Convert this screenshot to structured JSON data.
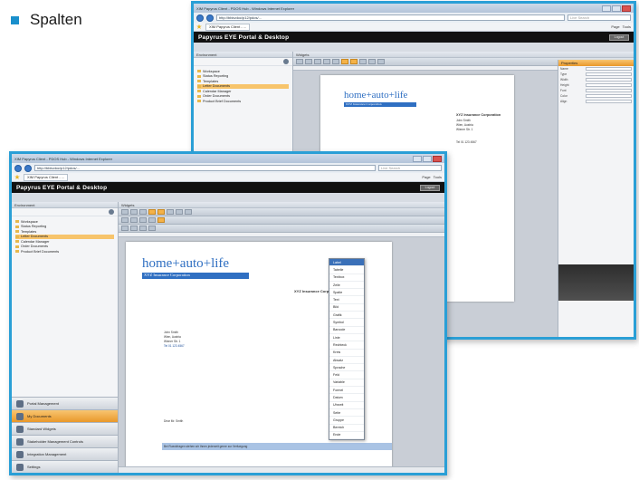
{
  "slide": {
    "bullet": "Spalten",
    "accent_color": "#1a8fcc",
    "frame_color": "#2a9fd6"
  },
  "browser": {
    "title": "XIM Papyrus Client - PDOS Hub - Windows Internet Explorer",
    "url": "http://bbkvdoc/p12/pdos/...",
    "search_placeholder": "Live Search",
    "tab": "XIM Papyrus Client - ...",
    "tools": [
      "Page",
      "Tools"
    ]
  },
  "app": {
    "title": "Papyrus EYE Portal & Desktop",
    "logout": "Logout",
    "left_header": "Environment",
    "main_header": "Widgets",
    "tree": [
      "Workspace",
      "Status Reporting",
      "Templates",
      "Letter Documents",
      "Calendar Manager",
      "Order Documents",
      "Product Brief Documents"
    ],
    "accordion": [
      "Portal Management",
      "My Documents",
      "Standard Widgets",
      "Stakeholder Management Controls",
      "Integration Management",
      "Settings"
    ]
  },
  "document": {
    "logo": "home+auto+life",
    "logo_sub": "XYZ Insurance Corporation",
    "company": "XYZ Insurance Corporation",
    "address_lines": [
      "John Smith",
      "Wien, Austria",
      "Wiener Str. 1",
      "Tel 01 123 4567"
    ],
    "salutation": "Dear Mr. Smith",
    "highlight": "Bei Rueckfragen stehen wir Ihnen jederzeit gerne zur Verfuegung"
  },
  "dropdown": {
    "items": [
      "Label",
      "Tabelle",
      "Textbox",
      "Zeile",
      "Spalte",
      "Text",
      "Bild",
      "Grafik",
      "Symbol",
      "Barcode",
      "Linie",
      "Rechteck",
      "Kreis",
      "Absatz",
      "Sprache",
      "Feld",
      "Variable",
      "Formel",
      "Datum",
      "Uhrzeit",
      "Seite",
      "Gruppe",
      "Bereich",
      "Ende"
    ],
    "selected_index": 0
  },
  "right_panel": {
    "header": "Properties",
    "props": [
      "Name",
      "Type",
      "Width",
      "Height",
      "Font",
      "Color",
      "Align"
    ]
  }
}
